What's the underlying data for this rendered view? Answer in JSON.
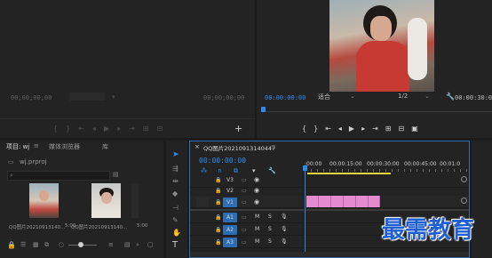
{
  "source_monitor": {
    "timecode_left": "00;00;00;00",
    "timecode_right": "00;00;00;00",
    "transport_icons": [
      "mark-in-icon",
      "mark-out-icon",
      "go-to-in-icon",
      "step-back-icon",
      "play-icon",
      "step-forward-icon",
      "go-to-out-icon",
      "insert-icon",
      "overwrite-icon",
      "export-frame-icon"
    ]
  },
  "program_monitor": {
    "timecode": "00:00:00:00",
    "fit_select": "适合",
    "resolution_select": "1/2",
    "timecode_right": "00:00:30:00"
  },
  "project_panel": {
    "tab_project": "项目: wj",
    "tab_media_browser": "媒体浏览器",
    "tab_library": "库",
    "project_file": "wj.prproj",
    "clips": [
      {
        "name": "QQ图片20210913140...",
        "duration": "5:00"
      },
      {
        "name": "QQ图片20210913140...",
        "duration": "5:00"
      }
    ]
  },
  "timeline": {
    "sequence_name": "QQ图片20210913140447",
    "timecode": "00:00:00:00",
    "ruler_ticks": [
      ":00:00",
      "00:00:15:00",
      "00:00:30:00",
      "00:00:45:00",
      "00:01:0"
    ],
    "video_tracks": [
      "V3",
      "V2",
      "V1"
    ],
    "audio_tracks": [
      "A1",
      "A2",
      "A3"
    ],
    "track_m": "M",
    "track_s": "S"
  },
  "watermark": "最需教育",
  "colors": {
    "accent_blue": "#2d8ceb",
    "clip_pink": "#e48bd0",
    "in_out_yellow": "#e3d53a",
    "panel": "#232323",
    "background": "#1b1b1b"
  }
}
